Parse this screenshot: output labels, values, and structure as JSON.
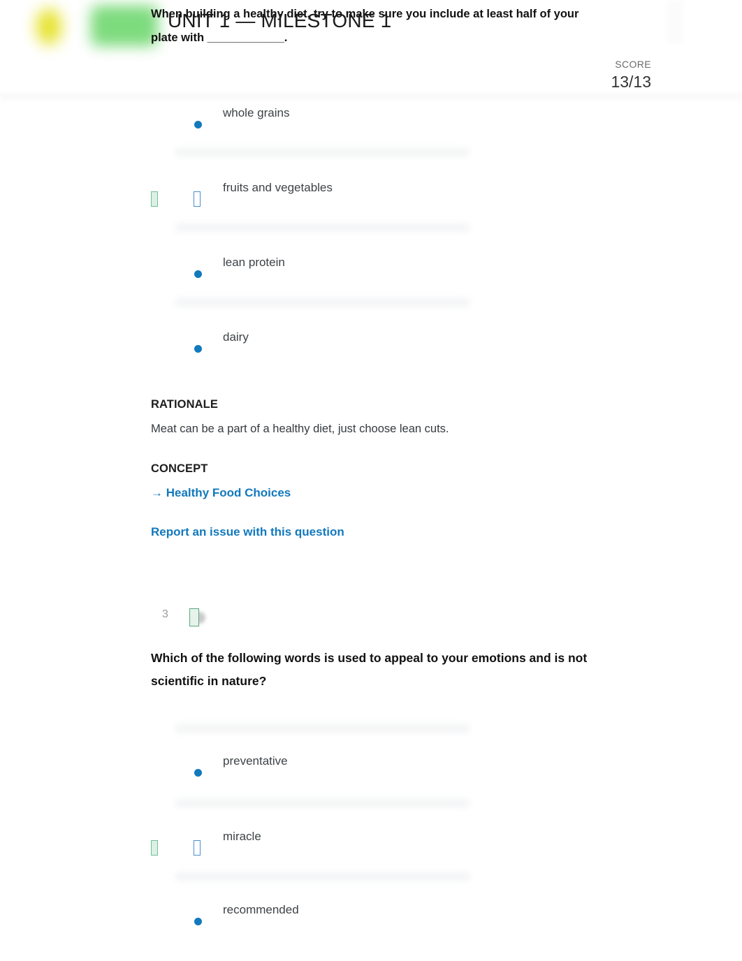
{
  "header": {
    "unit_title": "UNIT 1 — MILESTONE 1",
    "question_text": "When building a healthy diet, try to make sure you include at least half of your plate with ____________.",
    "score_label": "SCORE",
    "score_value": "13/13",
    "logo_yellow": "#e3e017",
    "logo_green": "#72d872"
  },
  "colors": {
    "accent_blue": "#1279bd",
    "correct_green": "#6fbf95",
    "text_dark": "#343a3f",
    "muted_gray": "#9a9a9a"
  },
  "question_2": {
    "options": [
      {
        "label": "whole grains",
        "selected": false,
        "correct": false
      },
      {
        "label": "fruits and vegetables",
        "selected": true,
        "correct": true
      },
      {
        "label": "lean protein",
        "selected": false,
        "correct": false
      },
      {
        "label": "dairy",
        "selected": false,
        "correct": false
      }
    ],
    "rationale_heading": "RATIONALE",
    "rationale_text": "Meat can be a part of a healthy diet, just choose lean cuts.",
    "concept_heading": "CONCEPT",
    "concept_arrow": "→",
    "concept_link": "Healthy Food Choices",
    "report_link": "Report an issue with this question"
  },
  "question_3": {
    "number": "3",
    "status_icon": "correct-check-icon",
    "prompt": "Which of the following words is used to appeal to your emotions and is not scientific in nature?",
    "options": [
      {
        "label": "preventative",
        "selected": false,
        "correct": false
      },
      {
        "label": "miracle",
        "selected": true,
        "correct": true
      },
      {
        "label": "recommended",
        "selected": false,
        "correct": false
      }
    ]
  }
}
